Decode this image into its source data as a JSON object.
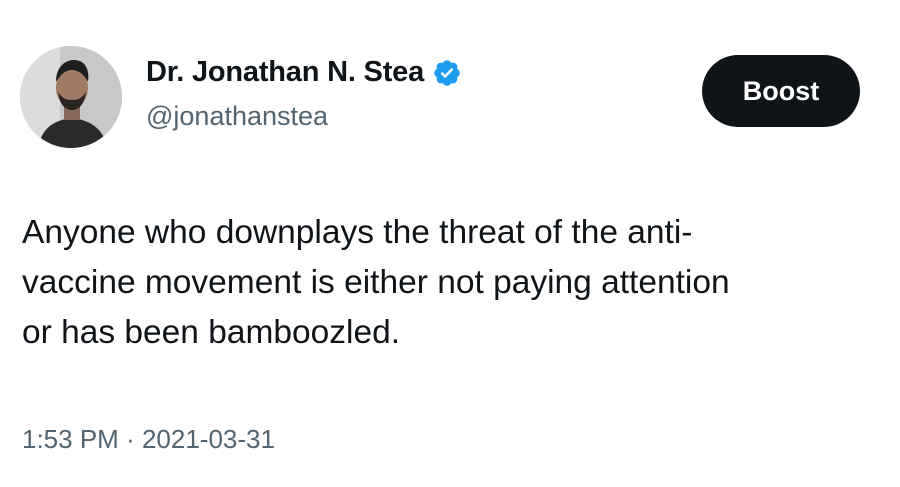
{
  "author": {
    "display_name": "Dr. Jonathan N. Stea",
    "handle": "@jonathanstea",
    "verified": true
  },
  "actions": {
    "boost_label": "Boost"
  },
  "post": {
    "text_lines": [
      "Anyone who downplays the threat of the anti-",
      "vaccine movement is either not paying attention",
      "or has been bamboozled."
    ]
  },
  "meta": {
    "time": "1:53 PM",
    "separator": "·",
    "date": "2021-03-31"
  },
  "colors": {
    "text_primary": "#0f1419",
    "text_secondary": "#536471",
    "verified_badge": "#1d9bf0",
    "button_bg": "#0f1419",
    "button_text": "#ffffff"
  }
}
